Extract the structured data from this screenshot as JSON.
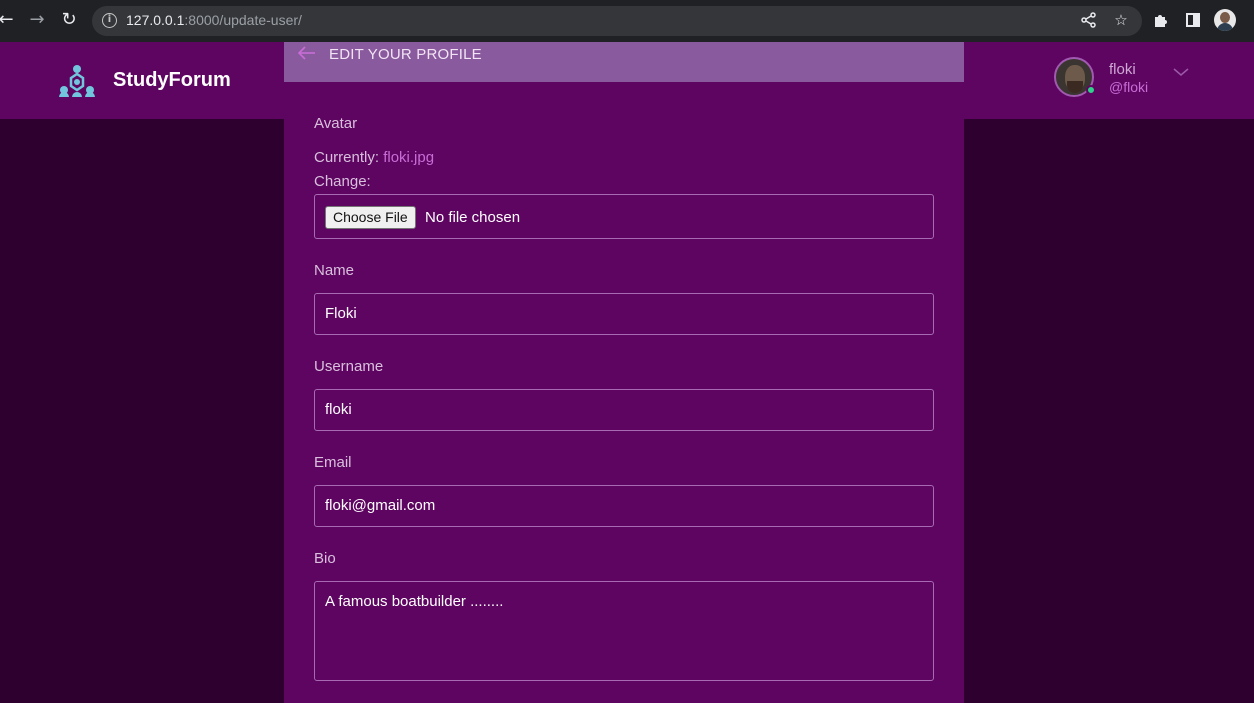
{
  "browser": {
    "url_host": "127.0.0.1",
    "url_rest": ":8000/update-user/"
  },
  "header": {
    "brand": "StudyForum",
    "user": {
      "name": "floki",
      "handle": "@floki"
    }
  },
  "panel": {
    "title": "EDIT YOUR PROFILE",
    "avatar": {
      "label": "Avatar",
      "currently_label": "Currently:",
      "current_file": "floki.jpg",
      "change_label": "Change:",
      "choose_button": "Choose File",
      "file_status": "No file chosen"
    },
    "name": {
      "label": "Name",
      "value": "Floki"
    },
    "username": {
      "label": "Username",
      "value": "floki"
    },
    "email": {
      "label": "Email",
      "value": "floki@gmail.com"
    },
    "bio": {
      "label": "Bio",
      "value": "A famous boatbuilder ........"
    }
  },
  "colors": {
    "page_bg": "#2d0030",
    "header_bg": "#5e0561",
    "panel_head_bg": "#8a5a9e",
    "accent": "#c86dd7",
    "online": "#30d18a"
  }
}
